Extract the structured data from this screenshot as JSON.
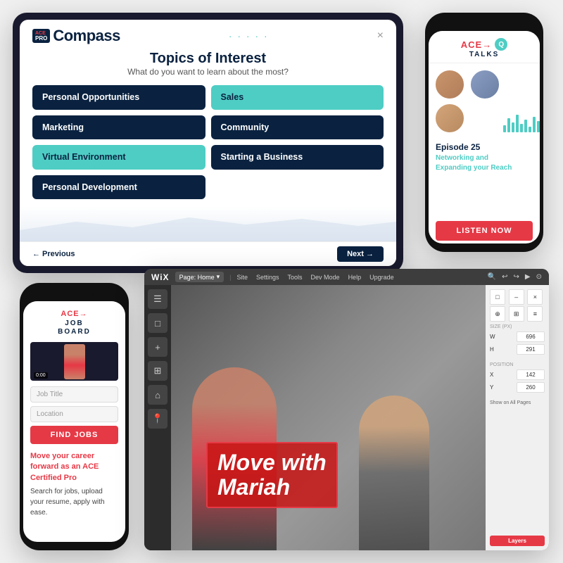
{
  "tablet": {
    "logo": "Compass",
    "logo_badge": "ACE PRO",
    "dots": "· · · · ·",
    "close_label": "×",
    "title": "Topics of Interest",
    "subtitle": "What do you want to learn about the most?",
    "topics": [
      {
        "label": "Personal Opportunities",
        "style": "dark"
      },
      {
        "label": "Sales",
        "style": "teal"
      },
      {
        "label": "Marketing",
        "style": "dark"
      },
      {
        "label": "Community",
        "style": "dark"
      },
      {
        "label": "Virtual Environment",
        "style": "teal"
      },
      {
        "label": "Starting a Business",
        "style": "dark"
      },
      {
        "label": "Personal Development",
        "style": "dark"
      }
    ],
    "prev_label": "← Previous",
    "next_label": "Next →"
  },
  "phone_right": {
    "logo_ace": "ACE→",
    "logo_talks": "TALKS",
    "episode_number": "Episode 25",
    "episode_title": "Networking and\nExpanding your Reach",
    "listen_label": "LISTEN NOW"
  },
  "phone_left": {
    "logo_ace": "ACE→",
    "logo_job": "JOB\nBOARD",
    "video_time": "0:00",
    "job_title_placeholder": "Job Title",
    "location_placeholder": "Location",
    "find_label": "FIND JOBS",
    "promo_heading": "Move your career forward as an ACE Certified Pro",
    "promo_body": "Search for jobs, upload your resume, apply with ease."
  },
  "wix": {
    "logo": "WiX",
    "page_selector": "Page: Home",
    "menu_items": [
      "Site",
      "Settings",
      "Tools",
      "Dev Mode",
      "Help",
      "Upgrade"
    ],
    "canvas_text_line1": "Move with",
    "canvas_text_line2": "Mariah",
    "right_panel": {
      "size_label": "Size (px)",
      "w_label": "W",
      "w_value": "696",
      "h_label": "H",
      "h_value": "291",
      "position_label": "Position",
      "x_label": "X",
      "x_value": "142",
      "y_label": "Y",
      "y_value": "260",
      "show_all_label": "Show on All Pages",
      "layers_label": "Layers"
    },
    "tools": [
      "☰",
      "□",
      "+",
      "⊞",
      "⌂",
      "📍"
    ]
  }
}
